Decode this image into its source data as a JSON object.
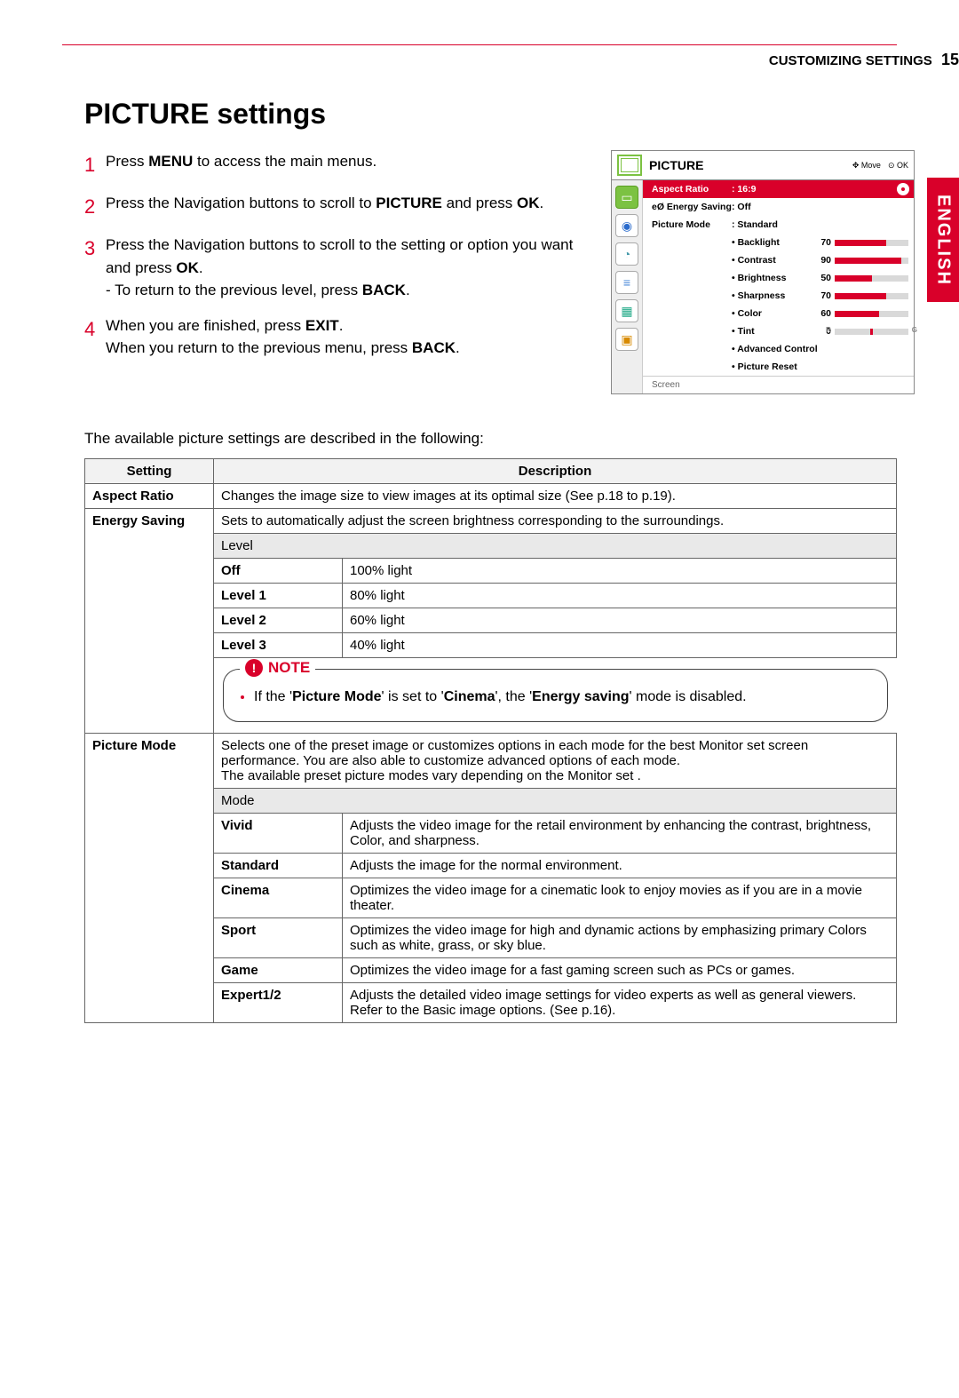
{
  "header": {
    "section": "CUSTOMIZING SETTINGS",
    "page": "15"
  },
  "language_tab": "ENGLISH",
  "title": "PICTURE settings",
  "steps": [
    {
      "num": "1",
      "parts": [
        "Press ",
        "MENU",
        " to access the main menus."
      ]
    },
    {
      "num": "2",
      "parts": [
        "Press the Navigation buttons to scroll to ",
        "PICTURE",
        " and press ",
        "OK",
        "."
      ]
    },
    {
      "num": "3",
      "parts": [
        "Press the Navigation buttons to scroll to the setting or option you want and press ",
        "OK",
        "."
      ],
      "sub": [
        "- To return to the previous level, press ",
        "BACK",
        "."
      ]
    },
    {
      "num": "4",
      "parts": [
        "When you are finished, press ",
        "EXIT",
        "."
      ],
      "cont": [
        "When you return to the previous menu, press ",
        "BACK",
        "."
      ]
    }
  ],
  "osd": {
    "title": "PICTURE",
    "move": "Move",
    "ok": "OK",
    "rows": {
      "aspect": {
        "label": "Aspect Ratio",
        "value": ": 16:9"
      },
      "energy": {
        "label": "eØ Energy Saving",
        "value": ": Off"
      },
      "pmode": {
        "label": "Picture Mode",
        "value": ": Standard"
      },
      "backlight": {
        "label": "• Backlight",
        "num": "70",
        "pct": 70
      },
      "contrast": {
        "label": "• Contrast",
        "num": "90",
        "pct": 90
      },
      "brightness": {
        "label": "• Brightness",
        "num": "50",
        "pct": 50
      },
      "sharpness": {
        "label": "• Sharpness",
        "num": "70",
        "pct": 70
      },
      "color": {
        "label": "• Color",
        "num": "60",
        "pct": 60
      },
      "tint": {
        "label": "• Tint",
        "num": "0",
        "pct": 50
      },
      "adv": {
        "label": "• Advanced Control"
      },
      "reset": {
        "label": "• Picture Reset"
      }
    },
    "footer": "Screen"
  },
  "intro": "The available picture settings are described in the following:",
  "table": {
    "hdr_setting": "Setting",
    "hdr_desc": "Description",
    "aspect": {
      "name": "Aspect Ratio",
      "desc": "Changes the image size to view images at its optimal size (See p.18  to p.19)."
    },
    "energy": {
      "name": "Energy Saving",
      "desc": "Sets to automatically adjust the screen brightness corresponding to the surroundings.",
      "level_hdr": "Level",
      "levels": [
        {
          "name": "Off",
          "desc": "100% light"
        },
        {
          "name": "Level 1",
          "desc": "80% light"
        },
        {
          "name": "Level 2",
          "desc": "60% light"
        },
        {
          "name": "Level 3",
          "desc": "40% light"
        }
      ],
      "note_label": "NOTE",
      "note_text": [
        "If the '",
        "Picture Mode",
        "' is set to '",
        "Cinema",
        "', the '",
        "Energy saving",
        "' mode is disabled."
      ]
    },
    "pmode": {
      "name": "Picture Mode",
      "desc": "Selects one of the preset image or customizes options in each mode for the best Monitor set screen performance. You are also able to customize advanced options of each mode.\nThe available preset picture modes vary depending on the Monitor set .",
      "mode_hdr": "Mode",
      "modes": [
        {
          "name": "Vivid",
          "desc": "Adjusts the video image for the retail environment by enhancing the contrast, brightness, Color, and sharpness."
        },
        {
          "name": "Standard",
          "desc": "Adjusts the image for the normal environment."
        },
        {
          "name": "Cinema",
          "desc": "Optimizes the video image for a cinematic look to enjoy movies as if you are in a movie theater."
        },
        {
          "name": "Sport",
          "desc": "Optimizes the video image for high and dynamic actions by emphasizing primary Colors such as white, grass, or sky blue."
        },
        {
          "name": "Game",
          "desc": "Optimizes the video image for a fast gaming screen such as PCs or games."
        },
        {
          "name": "Expert1/2",
          "desc": "Adjusts the detailed video image settings for video experts as well as general viewers. Refer to the Basic image options. (See p.16)."
        }
      ]
    }
  }
}
